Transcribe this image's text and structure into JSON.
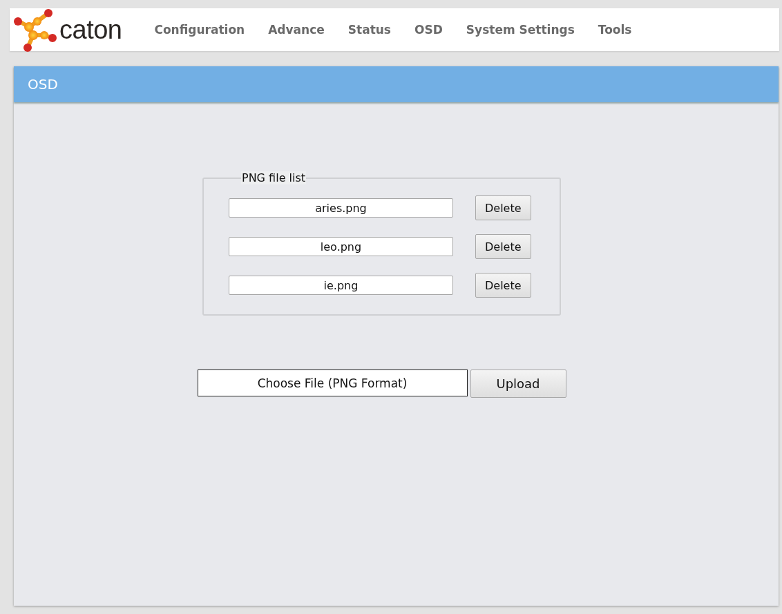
{
  "header": {
    "logo_text": "caton",
    "nav": [
      "Configuration",
      "Advance",
      "Status",
      "OSD",
      "System Settings",
      "Tools"
    ]
  },
  "panel": {
    "title": "OSD",
    "file_list": {
      "legend": "PNG file list",
      "files": [
        {
          "name": "aries.png",
          "button": "Delete"
        },
        {
          "name": "leo.png",
          "button": "Delete"
        },
        {
          "name": "ie.png",
          "button": "Delete"
        }
      ]
    },
    "upload": {
      "chooser": "Choose File (PNG Format)",
      "button": "Upload"
    }
  }
}
